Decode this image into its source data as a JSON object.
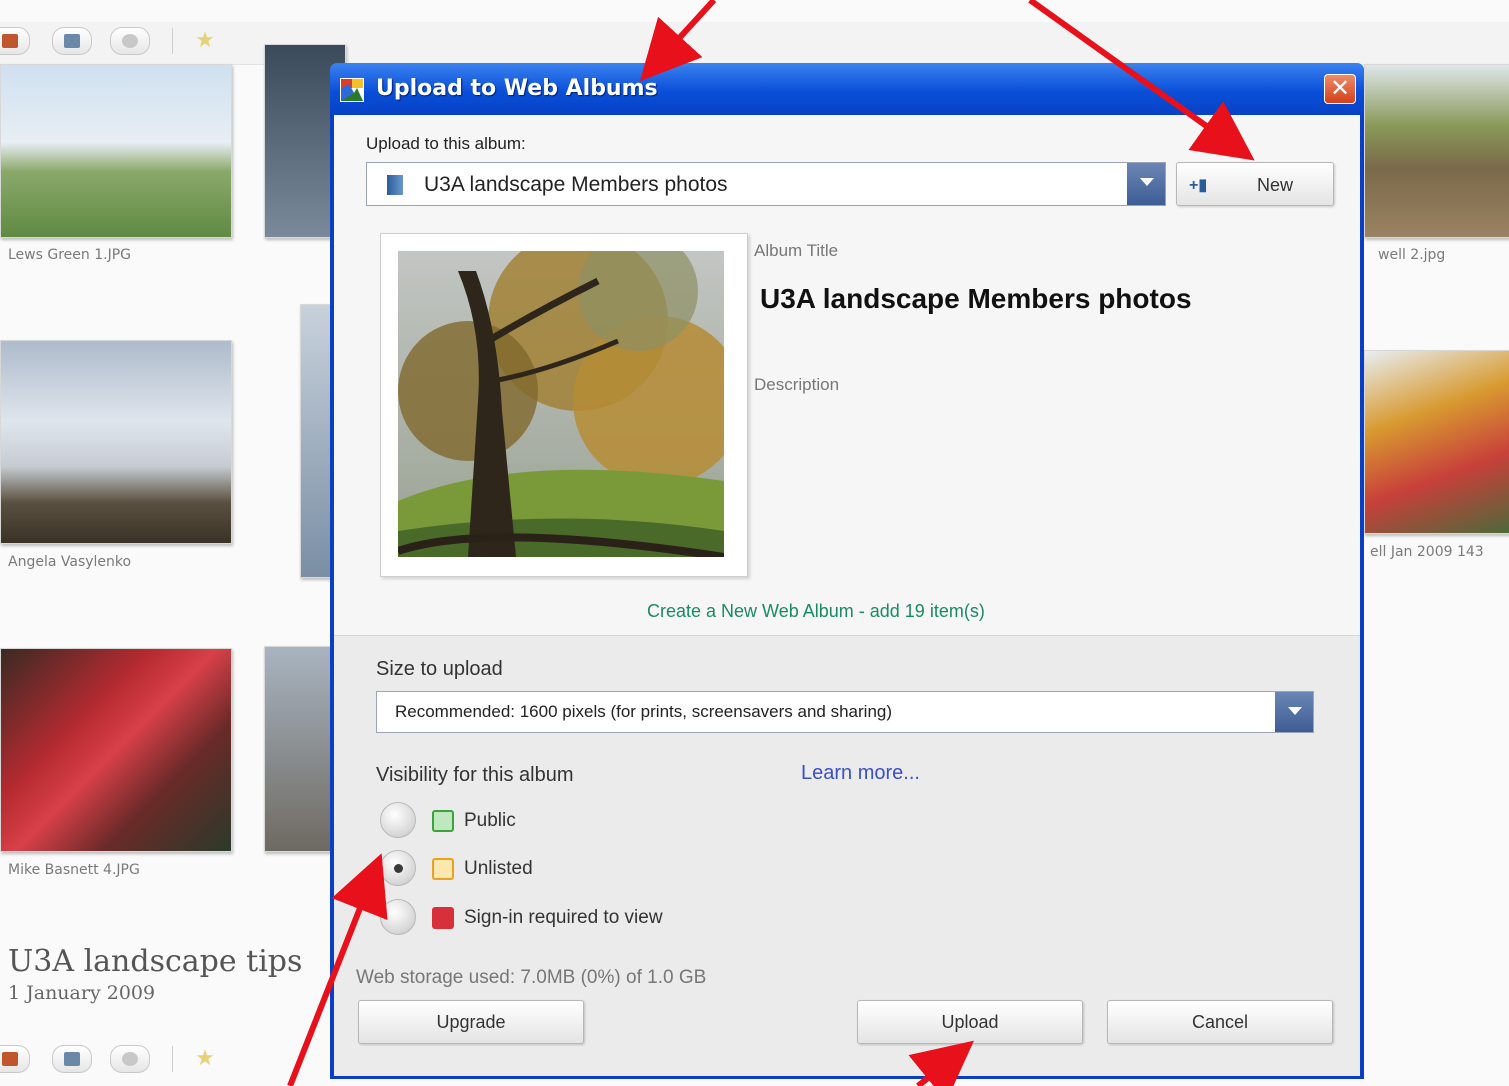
{
  "background": {
    "captions": {
      "photo1": "Lews Green 1.JPG",
      "photo2": "Angela Vasylenko",
      "photo3": "Mike Basnett 4.JPG",
      "right1": "well 2.jpg",
      "right2": "ell Jan 2009 143"
    },
    "album": {
      "title": "U3A landscape tips",
      "date": "1 January 2009"
    }
  },
  "dialog": {
    "title": "Upload to Web Albums",
    "upload_to_label": "Upload to this album:",
    "album_select_value": "U3A landscape Members photos",
    "new_button": "New",
    "album_title_label": "Album Title",
    "album_title_value": "U3A landscape Members photos",
    "description_label": "Description",
    "create_note": "Create a New Web Album - add 19 item(s)",
    "size_label": "Size to upload",
    "size_value": "Recommended: 1600 pixels (for prints, screensavers and sharing)",
    "visibility_label": "Visibility for this album",
    "learn_more": "Learn more...",
    "visibility_options": [
      {
        "label": "Public",
        "checked": false,
        "icon": "globe-icon",
        "color": "#3ba33b"
      },
      {
        "label": "Unlisted",
        "checked": true,
        "icon": "unlisted-icon",
        "color": "#f0a020"
      },
      {
        "label": "Sign-in required to view",
        "checked": false,
        "icon": "lock-icon",
        "color": "#d8303a"
      }
    ],
    "storage_text": "Web storage used: 7.0MB (0%) of 1.0 GB",
    "upgrade_button": "Upgrade",
    "upload_button": "Upload",
    "cancel_button": "Cancel"
  },
  "colors": {
    "titlebar": "#0a4fd8",
    "annotation_arrow": "#e8101a",
    "link": "#3a4fc8",
    "note": "#1a8a64"
  }
}
